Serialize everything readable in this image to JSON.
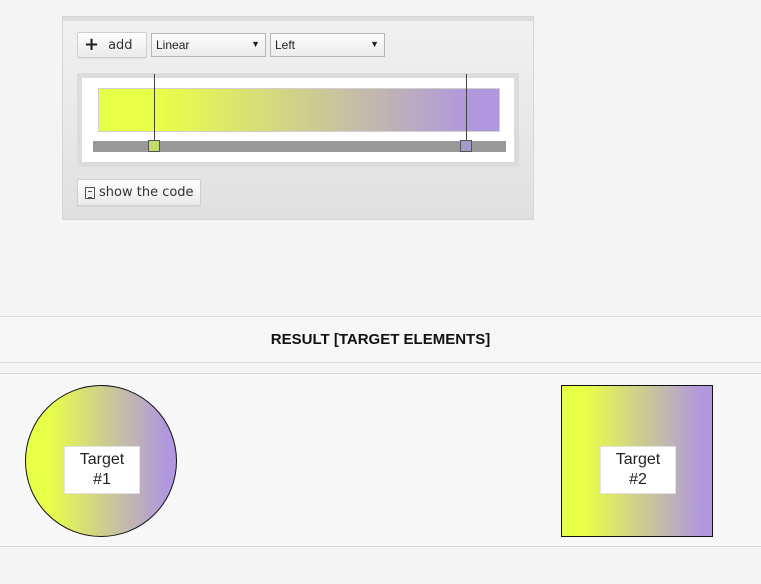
{
  "toolbar": {
    "add_label": "add",
    "type_select": {
      "value": "Linear"
    },
    "direction_select": {
      "value": "Left"
    }
  },
  "gradient": {
    "colors": [
      "#e8ff47",
      "#b097de"
    ],
    "stops": [
      {
        "color": "#c2db6e",
        "border": "#555555"
      },
      {
        "color": "#a59ac6",
        "border": "#555555"
      }
    ]
  },
  "show_code_label": "show the code",
  "result": {
    "heading": "RESULT [TARGET ELEMENTS]",
    "targets": [
      {
        "line1": "Target",
        "line2": "#1"
      },
      {
        "line1": "Target",
        "line2": "#2"
      }
    ]
  }
}
